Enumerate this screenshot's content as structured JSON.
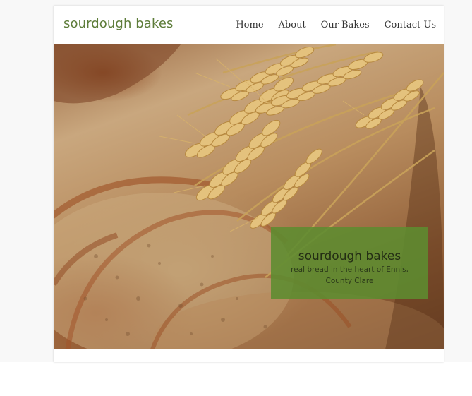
{
  "site": {
    "brand": "sourdough bakes",
    "nav": [
      {
        "label": "Home",
        "active": true
      },
      {
        "label": "About",
        "active": false
      },
      {
        "label": "Our Bakes",
        "active": false
      },
      {
        "label": "Contact Us",
        "active": false
      }
    ]
  },
  "hero": {
    "image_subject": "wheat-ears-and-sliced-bread-photo",
    "caption_title": "sourdough bakes",
    "caption_subtitle": "real bread in the heart of Ennis, County Clare"
  },
  "colors": {
    "brand_green": "#5e7d3a",
    "caption_bg": "#5d8c30",
    "nav_text": "#333333"
  }
}
